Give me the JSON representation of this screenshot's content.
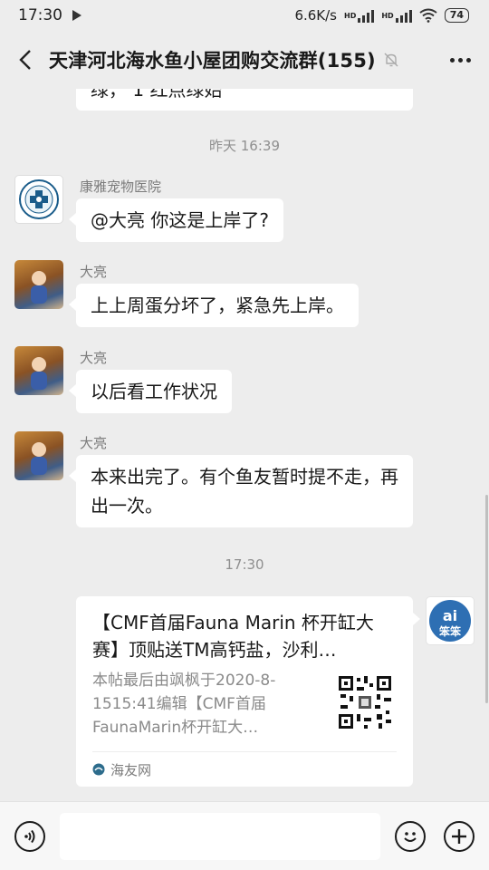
{
  "status": {
    "time": "17:30",
    "network_speed": "6.6K/s",
    "sim1": "HD",
    "sim2": "HD",
    "battery": "74"
  },
  "header": {
    "title": "天津河北海水鱼小屋团购交流群(155)",
    "icons": [
      "back-arrow-icon",
      "mute-bell-icon",
      "more-icon"
    ]
  },
  "chat": {
    "partial_message": "绿，    1 红点绿始",
    "dividers": [
      "昨天 16:39",
      "17:30"
    ],
    "messages": [
      {
        "sender": "康雅宠物医院",
        "text": "@大亮  你这是上岸了?"
      },
      {
        "sender": "大亮",
        "text": "上上周蛋分坏了，紧急先上岸。"
      },
      {
        "sender": "大亮",
        "text": "以后看工作状况"
      },
      {
        "sender": "大亮",
        "text": "本来出完了。有个鱼友暂时提不走，再出一次。"
      }
    ],
    "link_card": {
      "title": "【CMF首届Fauna Marin 杯开缸大赛】顶贴送TM高钙盐，沙利…",
      "description": "本帖最后由飒枫于2020-8-1515:41编辑【CMF首届FaunaMarin杯开缸大…",
      "source": "海友网",
      "sender_avatar_text": "ai 笨笨"
    }
  },
  "input": {
    "placeholder": "",
    "icons": [
      "voice-icon",
      "emoji-icon",
      "plus-icon"
    ]
  },
  "colors": {
    "background": "#ededed",
    "bubble": "#ffffff",
    "hospital_avatar": "#1a5c8a",
    "brand_avatar": "#2e6fb3"
  }
}
